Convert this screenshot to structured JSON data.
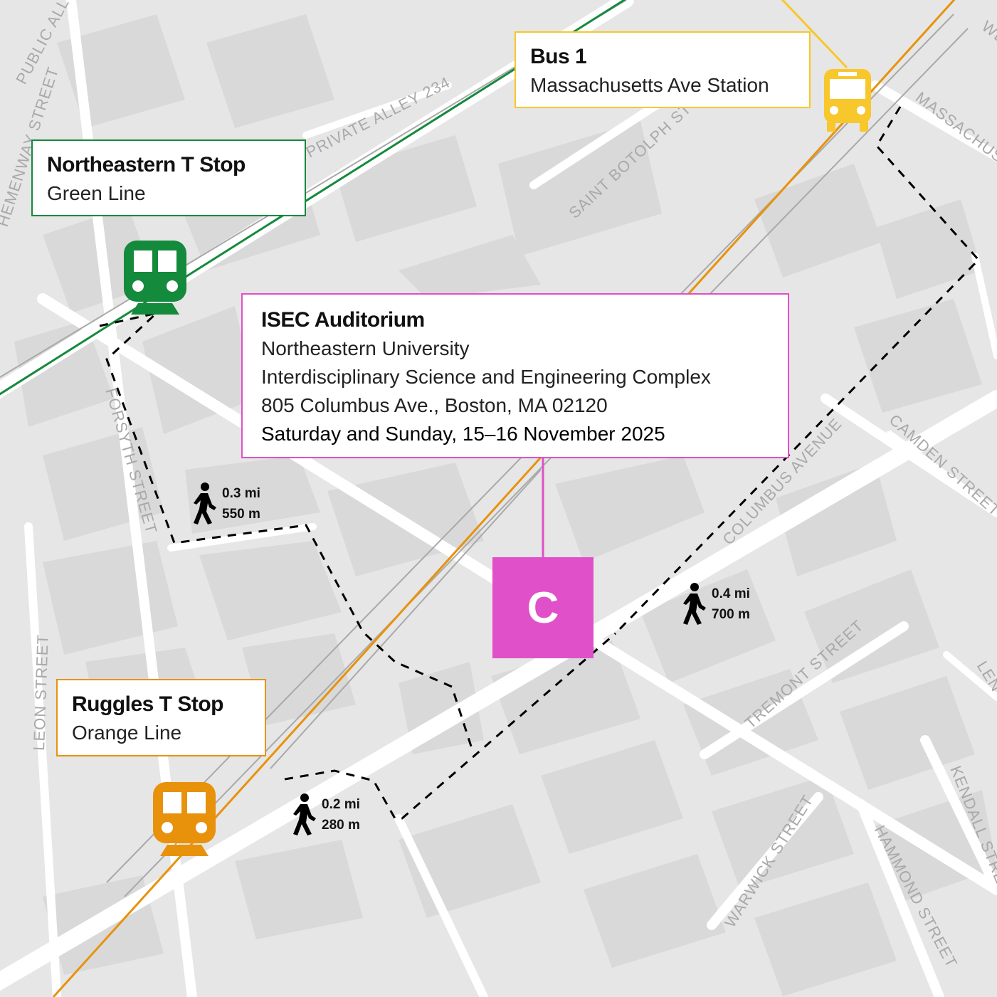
{
  "colors": {
    "green_line": "#148a3c",
    "orange_line": "#e8920c",
    "bus": "#f7c72c",
    "venue": "#e050c8",
    "walk_path": "#000000",
    "map_bg": "#e6e6e6",
    "road": "#ffffff"
  },
  "streets": {
    "public_alley": "PUBLIC ALL",
    "hemenway": "HEMENWAY STREET",
    "private_alley": "PRIVATE ALLEY 234",
    "saint_botolph": "SAINT BOTOLPH ST",
    "massachusetts": "MASSACHUSE",
    "forsyth": "FORSYTH STREET",
    "camden": "CAMDEN STREET",
    "columbus": "COLUMBUS AVENUE",
    "leon": "LEON STREET",
    "tremont": "TREMONT STREET",
    "warwick": "WARWICK STREET",
    "hammond": "HAMMOND STREET",
    "kendall": "KENDALL STRE",
    "len": "LEN",
    "we": "WE"
  },
  "stops": {
    "northeastern": {
      "title": "Northeastern T Stop",
      "subtitle": "Green Line",
      "icon": "train-icon"
    },
    "bus": {
      "title": "Bus 1",
      "subtitle": "Massachusetts Ave Station",
      "icon": "bus-icon"
    },
    "ruggles": {
      "title": "Ruggles T Stop",
      "subtitle": "Orange Line",
      "icon": "train-icon"
    }
  },
  "venue": {
    "title": "ISEC Auditorium",
    "lines": [
      "Northeastern University",
      "Interdisciplinary Science and Engineering Complex",
      "805 Columbus Ave., Boston, MA 02120"
    ],
    "date": "Saturday and Sunday, 15–16 November 2025",
    "marker_letter": "C"
  },
  "walks": {
    "from_northeastern": {
      "miles": "0.3 mi",
      "meters": "550 m"
    },
    "from_bus": {
      "miles": "0.4 mi",
      "meters": "700 m"
    },
    "from_ruggles": {
      "miles": "0.2 mi",
      "meters": "280 m"
    }
  }
}
